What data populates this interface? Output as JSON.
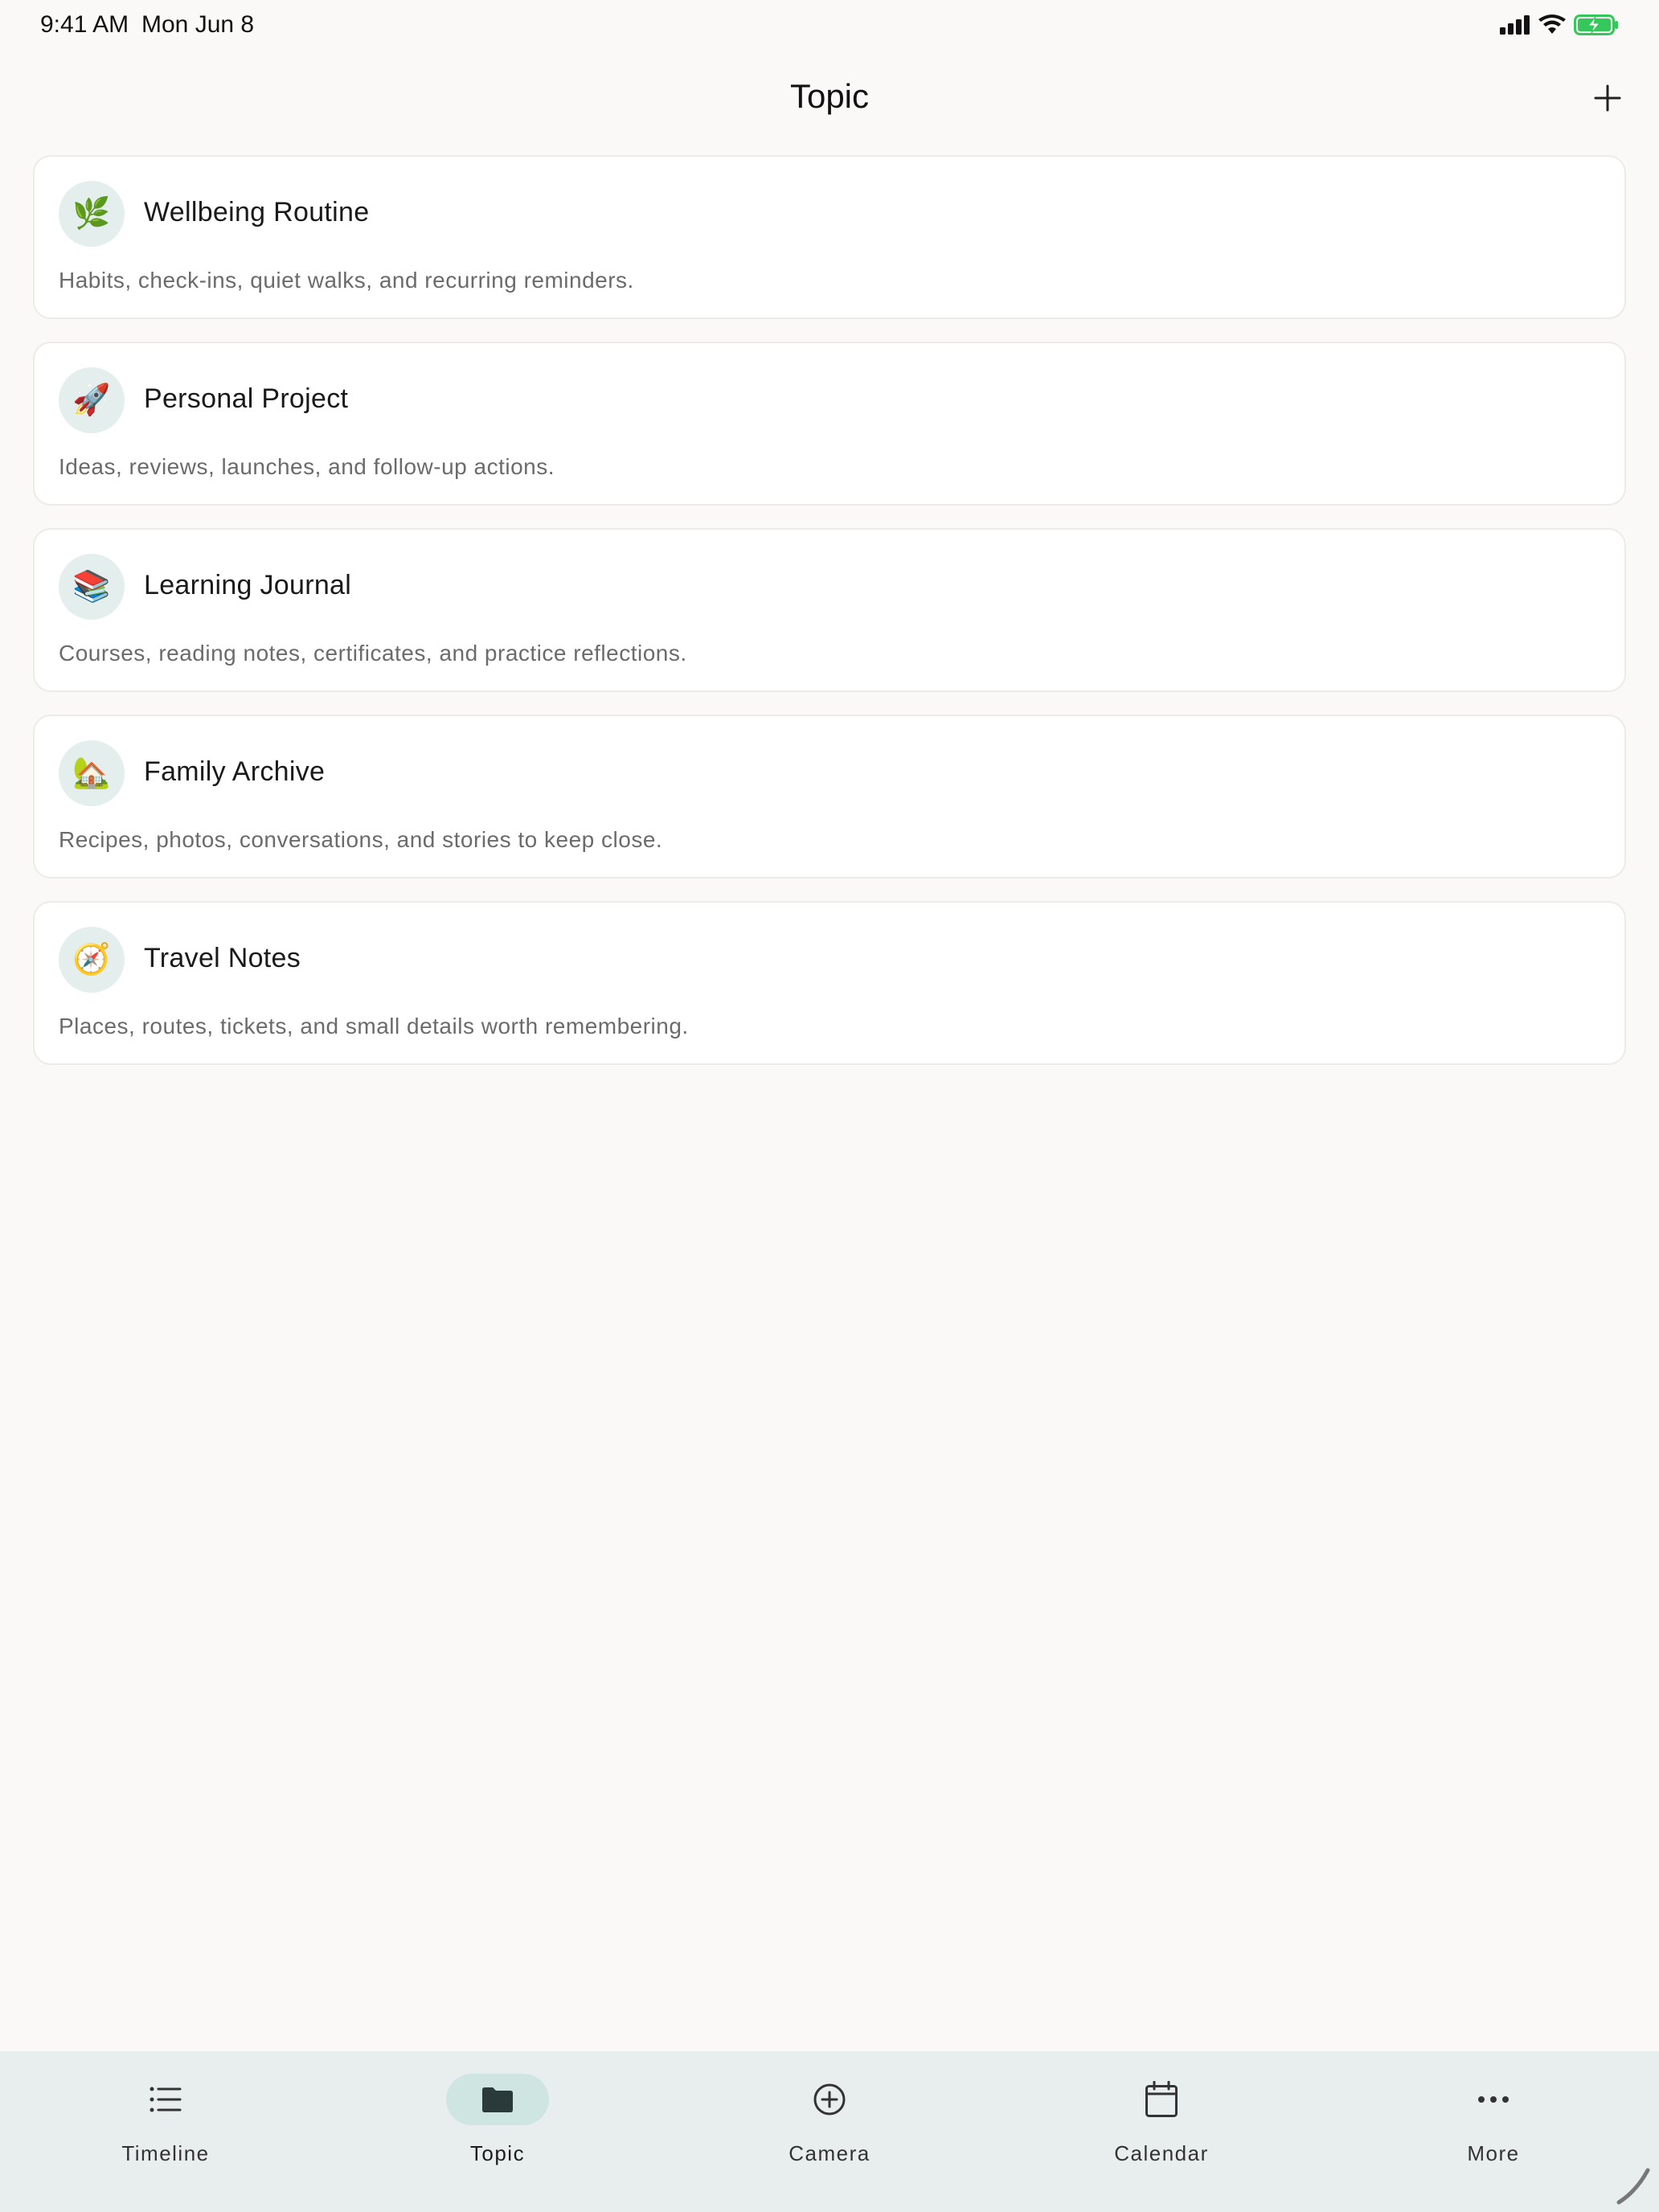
{
  "status_bar": {
    "time": "9:41 AM",
    "date": "Mon Jun 8"
  },
  "header": {
    "title": "Topic",
    "add_icon": "plus-icon"
  },
  "topics": [
    {
      "icon": "🌿",
      "icon_name": "herb-icon",
      "name": "Wellbeing Routine",
      "description": "Habits, check-ins, quiet walks, and recurring reminders."
    },
    {
      "icon": "🚀",
      "icon_name": "rocket-icon",
      "name": "Personal Project",
      "description": "Ideas, reviews, launches, and follow-up actions."
    },
    {
      "icon": "📚",
      "icon_name": "books-icon",
      "name": "Learning Journal",
      "description": "Courses, reading notes, certificates, and practice reflections."
    },
    {
      "icon": "🏡",
      "icon_name": "house-garden-icon",
      "name": "Family Archive",
      "description": "Recipes, photos, conversations, and stories to keep close."
    },
    {
      "icon": "🧭",
      "icon_name": "compass-icon",
      "name": "Travel Notes",
      "description": "Places, routes, tickets, and small details worth remembering."
    }
  ],
  "tab_bar": {
    "tabs": [
      {
        "label": "Timeline",
        "icon": "list-icon",
        "active": false
      },
      {
        "label": "Topic",
        "icon": "folder-icon",
        "active": true
      },
      {
        "label": "Camera",
        "icon": "plus-circle-icon",
        "active": false
      },
      {
        "label": "Calendar",
        "icon": "calendar-icon",
        "active": false
      },
      {
        "label": "More",
        "icon": "ellipsis-icon",
        "active": false
      }
    ]
  },
  "colors": {
    "background": "#faf9f7",
    "card": "#ffffff",
    "icon_bg": "#e4eeec",
    "tab_bar": "#e8eeed",
    "active_pill": "#cfe5e2",
    "battery": "#34c759"
  }
}
